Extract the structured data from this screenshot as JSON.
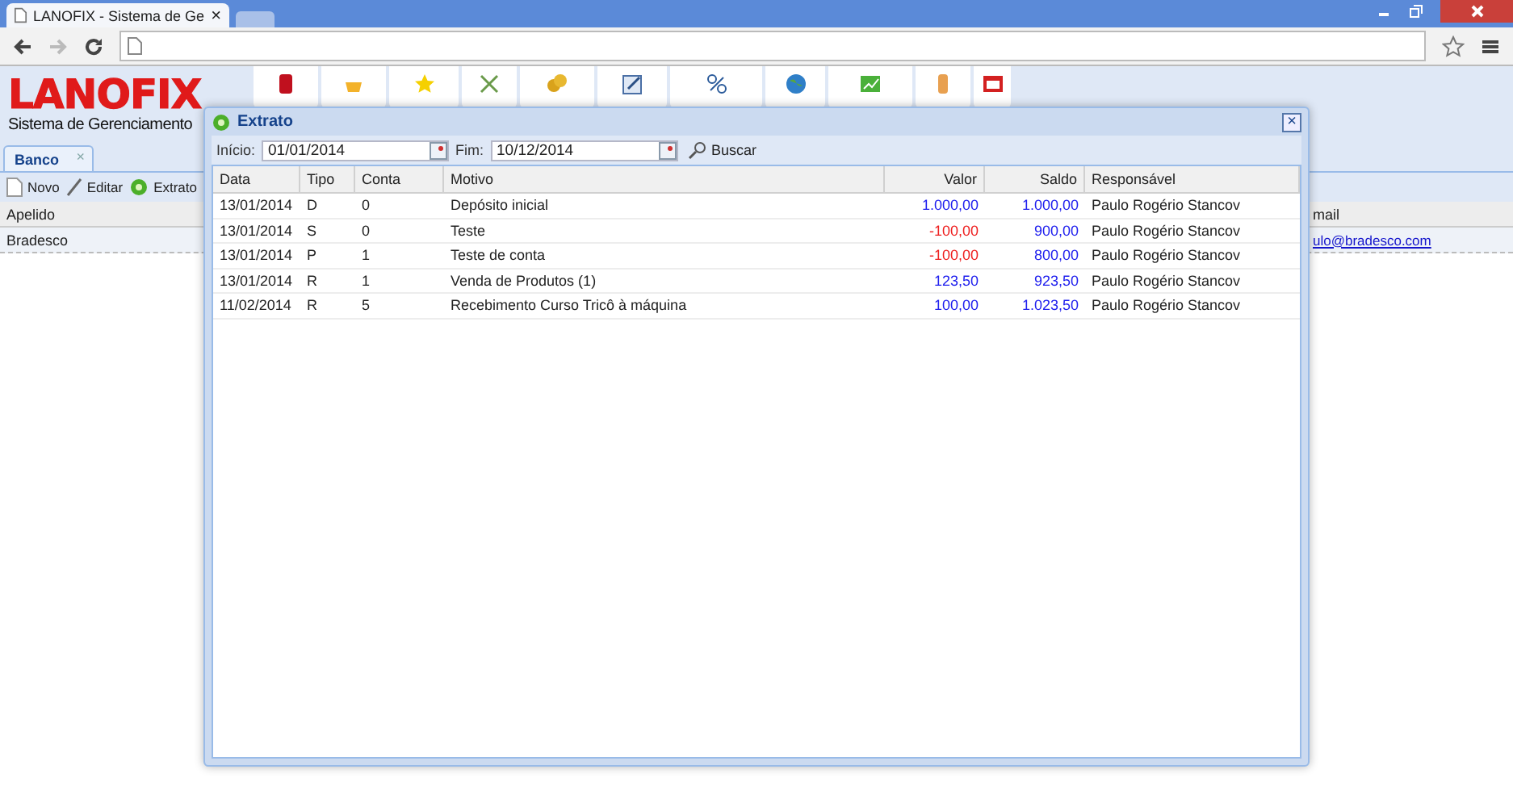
{
  "browser": {
    "tab_title": "LANOFIX - Sistema de Ge",
    "tab_close": "×"
  },
  "app": {
    "logo": "LANOFIX",
    "subtitle": "Sistema de Gerenciamento"
  },
  "tabs": [
    {
      "label": "Banco",
      "selected": true,
      "close": "×"
    }
  ],
  "actions": [
    {
      "label": "Novo",
      "kind": "new"
    },
    {
      "label": "Editar",
      "kind": "edit"
    },
    {
      "label": "Extrato",
      "kind": "statement"
    }
  ],
  "table": {
    "columns": [
      "Apelido",
      "mail"
    ],
    "rows": [
      {
        "cells": [
          "Bradesco",
          "ulo@bradesco.com"
        ]
      }
    ]
  },
  "dialog": {
    "title": "Extrato",
    "close": "×",
    "filters": [
      {
        "label": "Início:",
        "value": "01/01/2014"
      },
      {
        "label": "Fim:",
        "value": "10/12/2014"
      }
    ],
    "search_button": "Buscar",
    "columns": [
      "Data",
      "Tipo",
      "Conta",
      "Motivo",
      "Valor",
      "Saldo",
      "Responsável"
    ],
    "rows": [
      {
        "date": "13/01/2014",
        "type": "D",
        "account": "0",
        "reason": "Depósito inicial",
        "amount": "1.000,00",
        "kind": "credit",
        "balance": "1.000,00",
        "user": "Paulo Rogério Stancov"
      },
      {
        "date": "13/01/2014",
        "type": "S",
        "account": "0",
        "reason": "Teste",
        "amount": "-100,00",
        "kind": "debit",
        "balance": "900,00",
        "user": "Paulo Rogério Stancov"
      },
      {
        "date": "13/01/2014",
        "type": "P",
        "account": "1",
        "reason": "Teste de conta",
        "amount": "-100,00",
        "kind": "debit",
        "balance": "800,00",
        "user": "Paulo Rogério Stancov"
      },
      {
        "date": "13/01/2014",
        "type": "R",
        "account": "1",
        "reason": "Venda de Produtos (1)",
        "amount": "123,50",
        "kind": "credit",
        "balance": "923,50",
        "user": "Paulo Rogério Stancov"
      },
      {
        "date": "11/02/2014",
        "type": "R",
        "account": "5",
        "reason": "Recebimento Curso Tricô à máquina",
        "amount": "100,00",
        "kind": "credit",
        "balance": "1.023,50",
        "user": "Paulo Rogério Stancov"
      }
    ]
  }
}
